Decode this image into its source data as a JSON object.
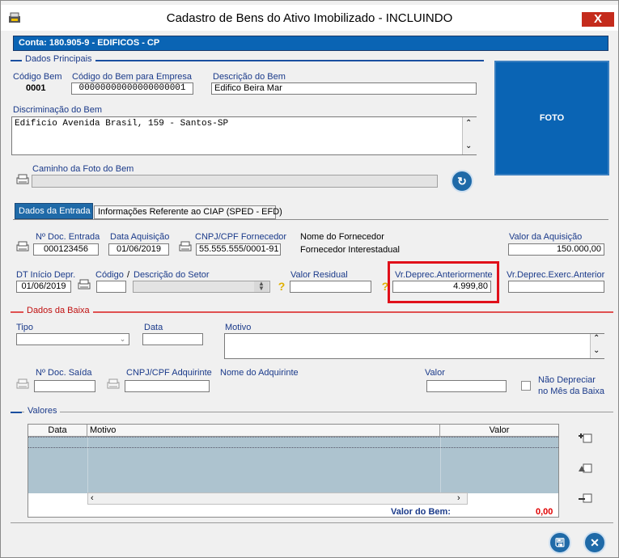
{
  "window": {
    "title": "Cadastro de Bens do Ativo Imobilizado   -   INCLUINDO",
    "close_label": "X"
  },
  "account": {
    "text": "Conta:   180.905-9     - EDIFICOS - CP"
  },
  "dados_principais": {
    "section_title": "Dados Principais",
    "codigo_bem_label": "Código Bem",
    "codigo_bem_value": "0001",
    "codigo_empresa_label": "Código do Bem para Empresa",
    "codigo_empresa_value": "00000000000000000001",
    "descricao_label": "Descrição do Bem",
    "descricao_value": "Edifico Beira Mar",
    "discriminacao_label": "Discriminação do Bem",
    "discriminacao_value": "Edificio Avenida Brasil, 159 - Santos-SP",
    "caminho_foto_label": "Caminho da Foto do Bem",
    "caminho_foto_value": "",
    "foto_label": "FOTO"
  },
  "tabs": [
    {
      "label": "Dados da Entrada"
    },
    {
      "label": "Informações Referente ao CIAP (SPED - EFD)"
    }
  ],
  "entrada": {
    "doc_entrada_label": "Nº Doc. Entrada",
    "doc_entrada_value": "000123456",
    "data_aquisicao_label": "Data Aquisição",
    "data_aquisicao_value": "01/06/2019",
    "cnpj_fornecedor_label": "CNPJ/CPF Fornecedor",
    "cnpj_fornecedor_value": "55.555.555/0001-91",
    "nome_fornecedor_label": "Nome do Fornecedor",
    "nome_fornecedor_value": "Fornecedor Interestadual",
    "valor_aquisicao_label": "Valor da Aquisição",
    "valor_aquisicao_value": "150.000,00",
    "dt_inicio_label": "DT Início Depr.",
    "dt_inicio_value": "01/06/2019",
    "codigo_label": "Código",
    "slash": "/",
    "descricao_setor_label": "Descrição do Setor",
    "codigo_value": "",
    "descricao_setor_value": "",
    "valor_residual_label": "Valor Residual",
    "valor_residual_value": "",
    "vr_deprec_ant_label": "Vr.Deprec.Anteriormente",
    "vr_deprec_ant_value": "4.999,80",
    "vr_deprec_exerc_label": "Vr.Deprec.Exerc.Anterior",
    "vr_deprec_exerc_value": ""
  },
  "baixa": {
    "section_title": "Dados da Baixa",
    "tipo_label": "Tipo",
    "tipo_value": "",
    "data_label": "Data",
    "data_value": "",
    "motivo_label": "Motivo",
    "motivo_value": "",
    "doc_saida_label": "Nº Doc. Saída",
    "doc_saida_value": "",
    "cnpj_adquirinte_label": "CNPJ/CPF Adquirinte",
    "cnpj_adquirinte_value": "",
    "nome_adquirinte_label": "Nome do Adquirinte",
    "valor_label": "Valor",
    "valor_value": "",
    "nao_depreciar_label_1": "Não Depreciar",
    "nao_depreciar_label_2": "no Mês da Baixa"
  },
  "valores": {
    "section_title": "Valores",
    "columns": [
      "Data",
      "Motivo",
      "Valor"
    ],
    "valor_do_bem_label": "Valor do Bem:",
    "valor_do_bem_value": "0,00"
  },
  "colors": {
    "accent_blue": "#0a64b4",
    "tab_active": "#1f6aa8",
    "highlight_red": "#e0101a",
    "grid_row": "#adc3cf",
    "total_value_red": "#e00000"
  },
  "icons": {
    "printer": "printer-icon",
    "help": "help-icon",
    "save": "save-icon",
    "exit": "exit-icon",
    "add_row": "add-row-icon",
    "edit_row": "edit-row-icon",
    "delete_row": "delete-row-icon",
    "refresh": "refresh-icon"
  }
}
